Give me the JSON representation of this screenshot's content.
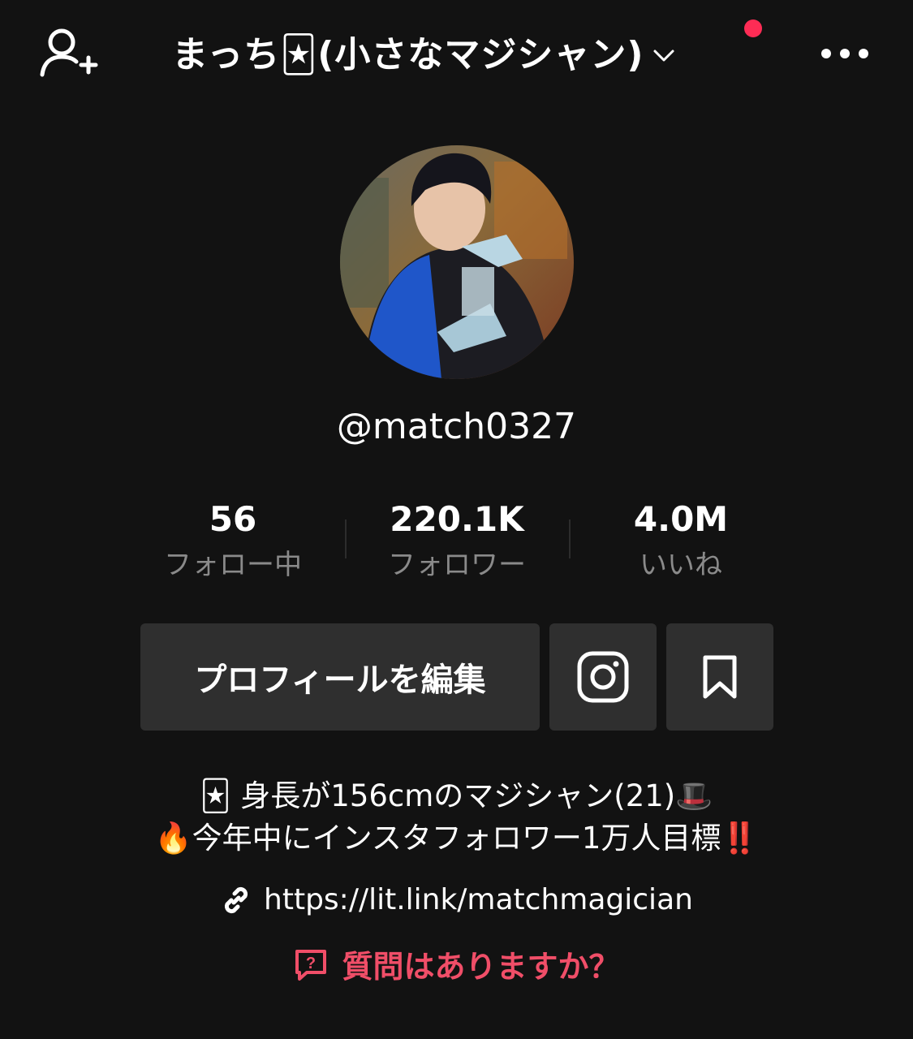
{
  "header": {
    "title": "まっち🃏(小さなマジシャン)",
    "add_friend_icon": "add-user-icon",
    "more_icon": "more-horizontal-icon",
    "dropdown_icon": "chevron-down-icon",
    "notification_dot_color": "#fe2c55"
  },
  "profile": {
    "handle": "@match0327",
    "avatar_alt": "profile photo"
  },
  "stats": [
    {
      "value": "56",
      "label": "フォロー中"
    },
    {
      "value": "220.1K",
      "label": "フォロワー"
    },
    {
      "value": "4.0M",
      "label": "いいね"
    }
  ],
  "actions": {
    "edit_profile": "プロフィールを編集",
    "instagram_icon": "instagram-icon",
    "bookmark_icon": "bookmark-icon"
  },
  "bio": {
    "line1": "🃏 身長が156cmのマジシャン(21)🎩",
    "line2": "🔥今年中にインスタフォロワー1万人目標‼️"
  },
  "link": {
    "url": "https://lit.link/matchmagician",
    "icon": "link-icon"
  },
  "qa": {
    "label": "質問はありますか？",
    "icon": "question-bubble-icon",
    "color": "#f04e68"
  }
}
